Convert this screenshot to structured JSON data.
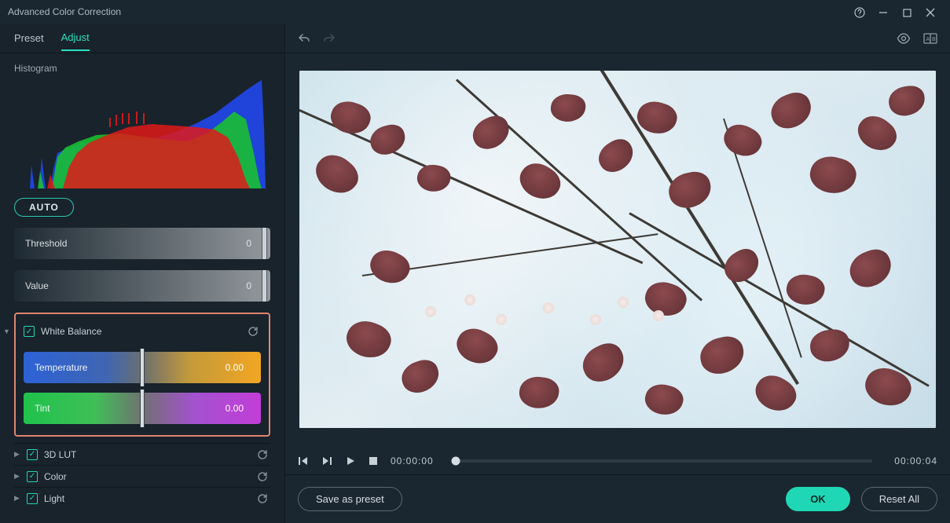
{
  "window": {
    "title": "Advanced Color Correction"
  },
  "tabs": {
    "preset": "Preset",
    "adjust": "Adjust"
  },
  "histogram": {
    "label": "Histogram",
    "auto_label": "AUTO"
  },
  "sliders": {
    "threshold": {
      "label": "Threshold",
      "value": "0"
    },
    "value": {
      "label": "Value",
      "value": "0"
    }
  },
  "white_balance": {
    "label": "White Balance",
    "temperature": {
      "label": "Temperature",
      "value": "0.00"
    },
    "tint": {
      "label": "Tint",
      "value": "0.00"
    }
  },
  "sections": {
    "lut": "3D LUT",
    "color": "Color",
    "light": "Light"
  },
  "player": {
    "current_time": "00:00:00",
    "total_time": "00:00:04"
  },
  "footer": {
    "save_preset": "Save as preset",
    "ok": "OK",
    "reset_all": "Reset All"
  }
}
